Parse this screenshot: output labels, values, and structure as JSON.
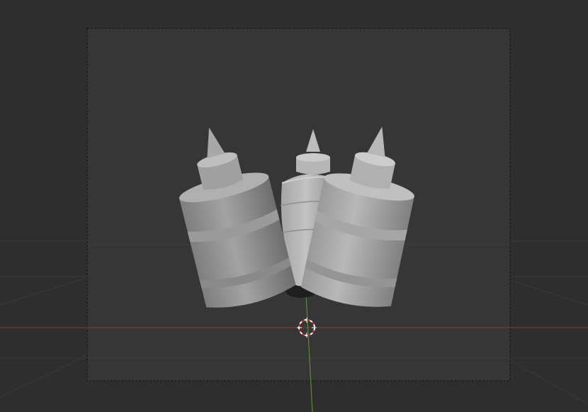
{
  "app": {
    "editor": "3D Viewport",
    "mode": "camera-view"
  },
  "scene": {
    "objects": [
      {
        "name": "bottle-left"
      },
      {
        "name": "bottle-center"
      },
      {
        "name": "bottle-right"
      }
    ],
    "axis_colors": {
      "x_axis": "#8a3a3a",
      "y_axis": "#5e8a3c"
    },
    "background_color": "#2e2e2e",
    "camera_frame_color": "#363636",
    "cursor_colors": [
      "#ffffff",
      "#c83232"
    ]
  }
}
